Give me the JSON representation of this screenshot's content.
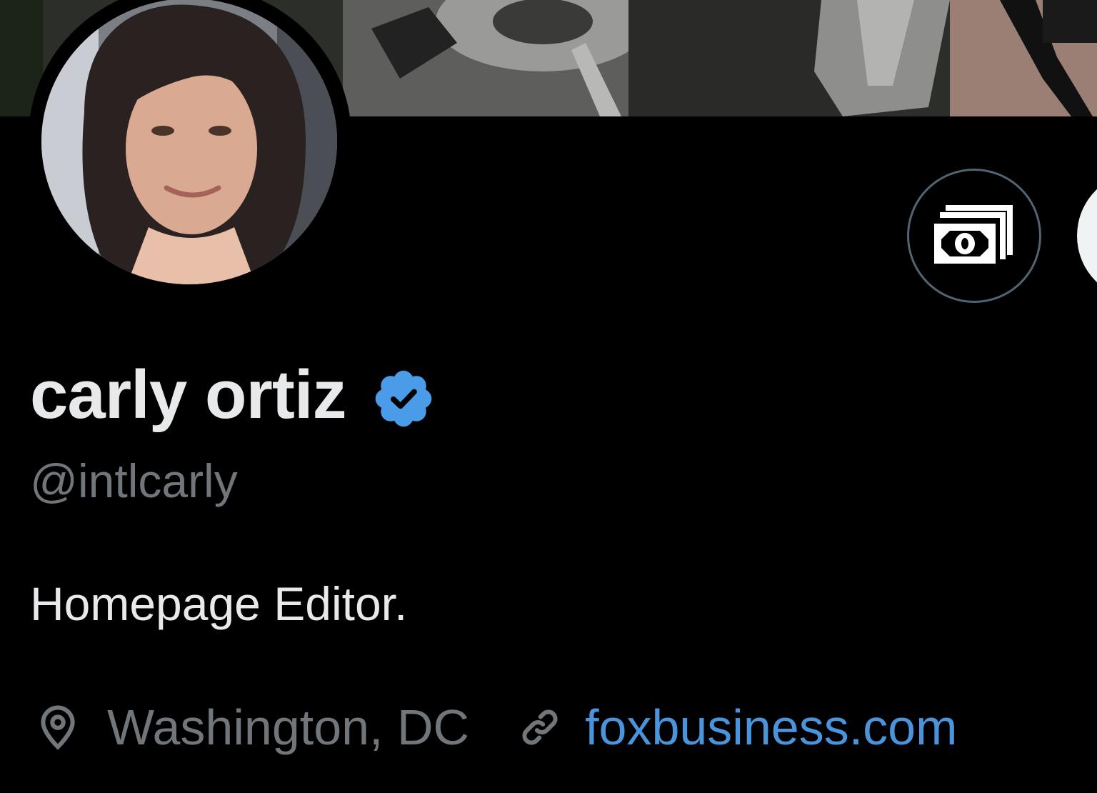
{
  "profile": {
    "display_name": "carly ortiz",
    "handle": "@intlcarly",
    "bio": "Homepage Editor.",
    "location": "Washington, DC",
    "website": "foxbusiness.com",
    "verified": true
  },
  "icons": {
    "verified": "verified-badge-icon",
    "tip": "money-icon",
    "location": "location-pin-icon",
    "link": "link-icon"
  },
  "colors": {
    "background": "#000000",
    "name": "#e7e9ea",
    "secondary_text": "#71767b",
    "link": "#4a94dc",
    "verified": "#4a9be8",
    "button_border": "#536471"
  }
}
